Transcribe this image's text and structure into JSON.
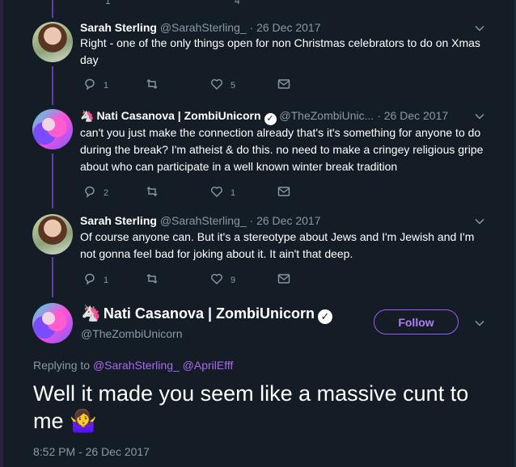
{
  "top_stub": {
    "reply_count": "1",
    "like_count": "4"
  },
  "tweets": [
    {
      "name": "Sarah Sterling",
      "handle": "@SarahSterling_",
      "date": "· 26 Dec 2017",
      "text": "Right - one of the only things open for non Christmas celebrators to do on Xmas day",
      "replies": "1",
      "retweets": "",
      "likes": "5"
    },
    {
      "name": "Nati Casanova | ZombiUnicorn",
      "emoji": "🦄",
      "verified": "✓",
      "handle": "@TheZombiUnic...",
      "date": "· 26 Dec 2017",
      "text": "can't you just make the connection already that's it's something for anyone to do during the break? I'm atheist & do this. no need to make a cringey religious gripe about who can participate in a well known winter break tradition",
      "replies": "2",
      "retweets": "",
      "likes": "1"
    },
    {
      "name": "Sarah Sterling",
      "handle": "@SarahSterling_",
      "date": "· 26 Dec 2017",
      "text": "Of course anyone can. But it's a stereotype about Jews and I'm Jewish and I'm not gonna feel bad for joking about it. It ain't that deep.",
      "replies": "1",
      "retweets": "",
      "likes": "9"
    }
  ],
  "main": {
    "emoji": "🦄",
    "name": "Nati Casanova | ZombiUnicorn",
    "verified": "✓",
    "handle": "@TheZombiUnicorn",
    "follow_label": "Follow",
    "replying_prefix": "Replying to ",
    "replying_to": [
      "@SarahSterling_",
      "@AprilEfff"
    ],
    "text": "Well it made you seem like a massive cunt to me 🤷‍♀️",
    "timestamp": "8:52 PM - 26 Dec 2017"
  },
  "icons": {
    "reply": "reply-icon",
    "retweet": "retweet-icon",
    "like": "heart-icon",
    "dm": "envelope-icon",
    "more": "chevron-down-icon"
  },
  "colors": {
    "background": "#141d26",
    "accent": "#a868f2",
    "muted": "#8899a6",
    "thread_line": "#5b3ea8"
  }
}
